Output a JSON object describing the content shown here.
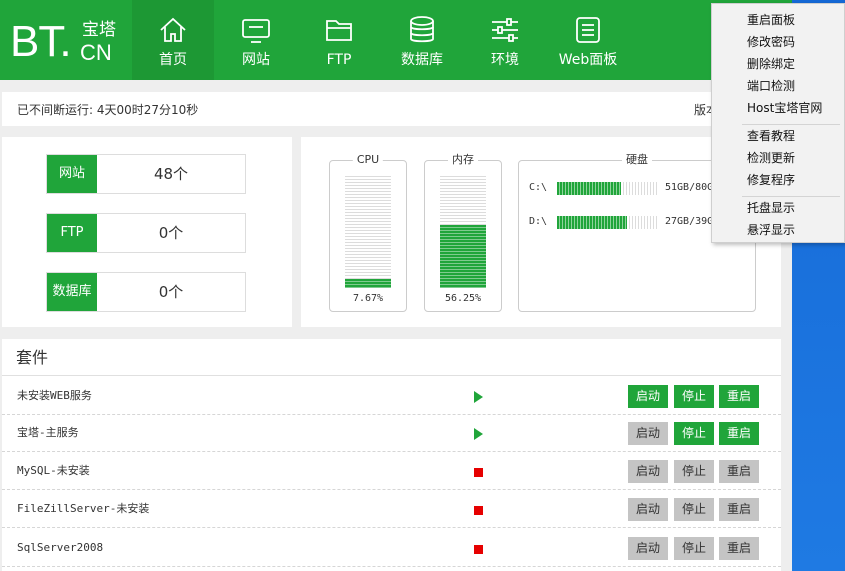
{
  "logo": {
    "main": "BT.",
    "sub_top": "宝塔",
    "sub_bottom": "CN"
  },
  "nav": [
    {
      "label": "首页",
      "icon": "home-icon",
      "active": true
    },
    {
      "label": "网站",
      "icon": "monitor-icon"
    },
    {
      "label": "FTP",
      "icon": "folder-icon"
    },
    {
      "label": "数据库",
      "icon": "database-icon"
    },
    {
      "label": "环境",
      "icon": "sliders-icon"
    },
    {
      "label": "Web面板",
      "icon": "list-icon"
    }
  ],
  "status": {
    "uptime": "已不间断运行: 4天00时27分10秒",
    "version": "版本"
  },
  "counts": [
    {
      "label": "网站",
      "value": "48个"
    },
    {
      "label": "FTP",
      "value": "0个"
    },
    {
      "label": "数据库",
      "value": "0个"
    }
  ],
  "gauges": {
    "cpu": {
      "title": "CPU",
      "percent": 7.67,
      "text": "7.67%"
    },
    "mem": {
      "title": "内存",
      "percent": 56.25,
      "text": "56.25%"
    }
  },
  "disk": {
    "title": "硬盘",
    "drives": [
      {
        "drive": "C:\\",
        "fill": 0.64,
        "size": "51GB/80G"
      },
      {
        "drive": "D:\\",
        "fill": 0.7,
        "size": "27GB/39G"
      }
    ]
  },
  "services": {
    "heading": "套件",
    "buttons": {
      "start": "启动",
      "stop": "停止",
      "restart": "重启"
    },
    "rows": [
      {
        "name": "未安装WEB服务",
        "state": "running",
        "enabled": [
          true,
          true,
          true
        ]
      },
      {
        "name": "宝塔-主服务",
        "state": "running",
        "enabled": [
          false,
          true,
          true
        ]
      },
      {
        "name": "MySQL-未安装",
        "state": "stopped",
        "enabled": [
          false,
          false,
          false
        ]
      },
      {
        "name": "FileZillServer-未安装",
        "state": "stopped",
        "enabled": [
          false,
          false,
          false
        ]
      },
      {
        "name": "SqlServer2008",
        "state": "stopped",
        "enabled": [
          false,
          false,
          false
        ]
      }
    ]
  },
  "context_menu": {
    "groups": [
      [
        "重启面板",
        "修改密码",
        "删除绑定",
        "端口检测",
        "Host宝塔官网"
      ],
      [
        "查看教程",
        "检测更新",
        "修复程序"
      ],
      [
        "托盘显示",
        "悬浮显示"
      ]
    ]
  },
  "colors": {
    "brand": "#20a53a",
    "stopped": "#e60000",
    "desktop": "#1a73dd"
  }
}
